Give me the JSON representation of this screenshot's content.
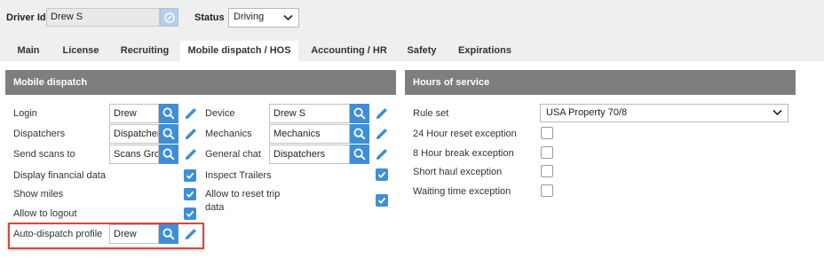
{
  "header": {
    "driver_id_label": "Driver Id",
    "driver_id_value": "Drew S",
    "status_label": "Status",
    "status_value": "Driving"
  },
  "tabs": [
    {
      "label": "Main",
      "active": false
    },
    {
      "label": "License",
      "active": false
    },
    {
      "label": "Recruiting",
      "active": false
    },
    {
      "label": "Mobile dispatch / HOS",
      "active": true
    },
    {
      "label": "Accounting / HR",
      "active": false
    },
    {
      "label": "Safety",
      "active": false
    },
    {
      "label": "Expirations",
      "active": false
    }
  ],
  "mobile_dispatch": {
    "title": "Mobile dispatch",
    "login": {
      "label": "Login",
      "value": "Drew"
    },
    "dispatchers": {
      "label": "Dispatchers",
      "value": "Dispatchers"
    },
    "send_scans_to": {
      "label": "Send scans to",
      "value": "Scans Group"
    },
    "display_financial_data": {
      "label": "Display financial data",
      "checked": true
    },
    "show_miles": {
      "label": "Show miles",
      "checked": true
    },
    "allow_to_logout": {
      "label": "Allow to logout",
      "checked": true
    },
    "auto_dispatch_profile": {
      "label": "Auto-dispatch profile",
      "value": "Drew"
    },
    "device": {
      "label": "Device",
      "value": "Drew S"
    },
    "mechanics": {
      "label": "Mechanics",
      "value": "Mechanics"
    },
    "general_chat": {
      "label": "General chat",
      "value": "Dispatchers"
    },
    "inspect_trailers": {
      "label": "Inspect Trailers",
      "checked": true
    },
    "allow_reset_trip_data": {
      "label_line1": "Allow to reset trip",
      "label_line2": "data",
      "checked": true
    }
  },
  "hours_of_service": {
    "title": "Hours of service",
    "rule_set": {
      "label": "Rule set",
      "value": "USA Property 70/8"
    },
    "reset_24h": {
      "label": "24 Hour reset exception",
      "checked": false
    },
    "break_8h": {
      "label": "8 Hour break exception",
      "checked": false
    },
    "short_haul": {
      "label": "Short haul exception",
      "checked": false
    },
    "waiting_time": {
      "label": "Waiting time exception",
      "checked": false
    }
  },
  "colors": {
    "accent": "#3d8fd8",
    "panel_header": "#7e7e7e",
    "highlight": "#d9473a"
  }
}
